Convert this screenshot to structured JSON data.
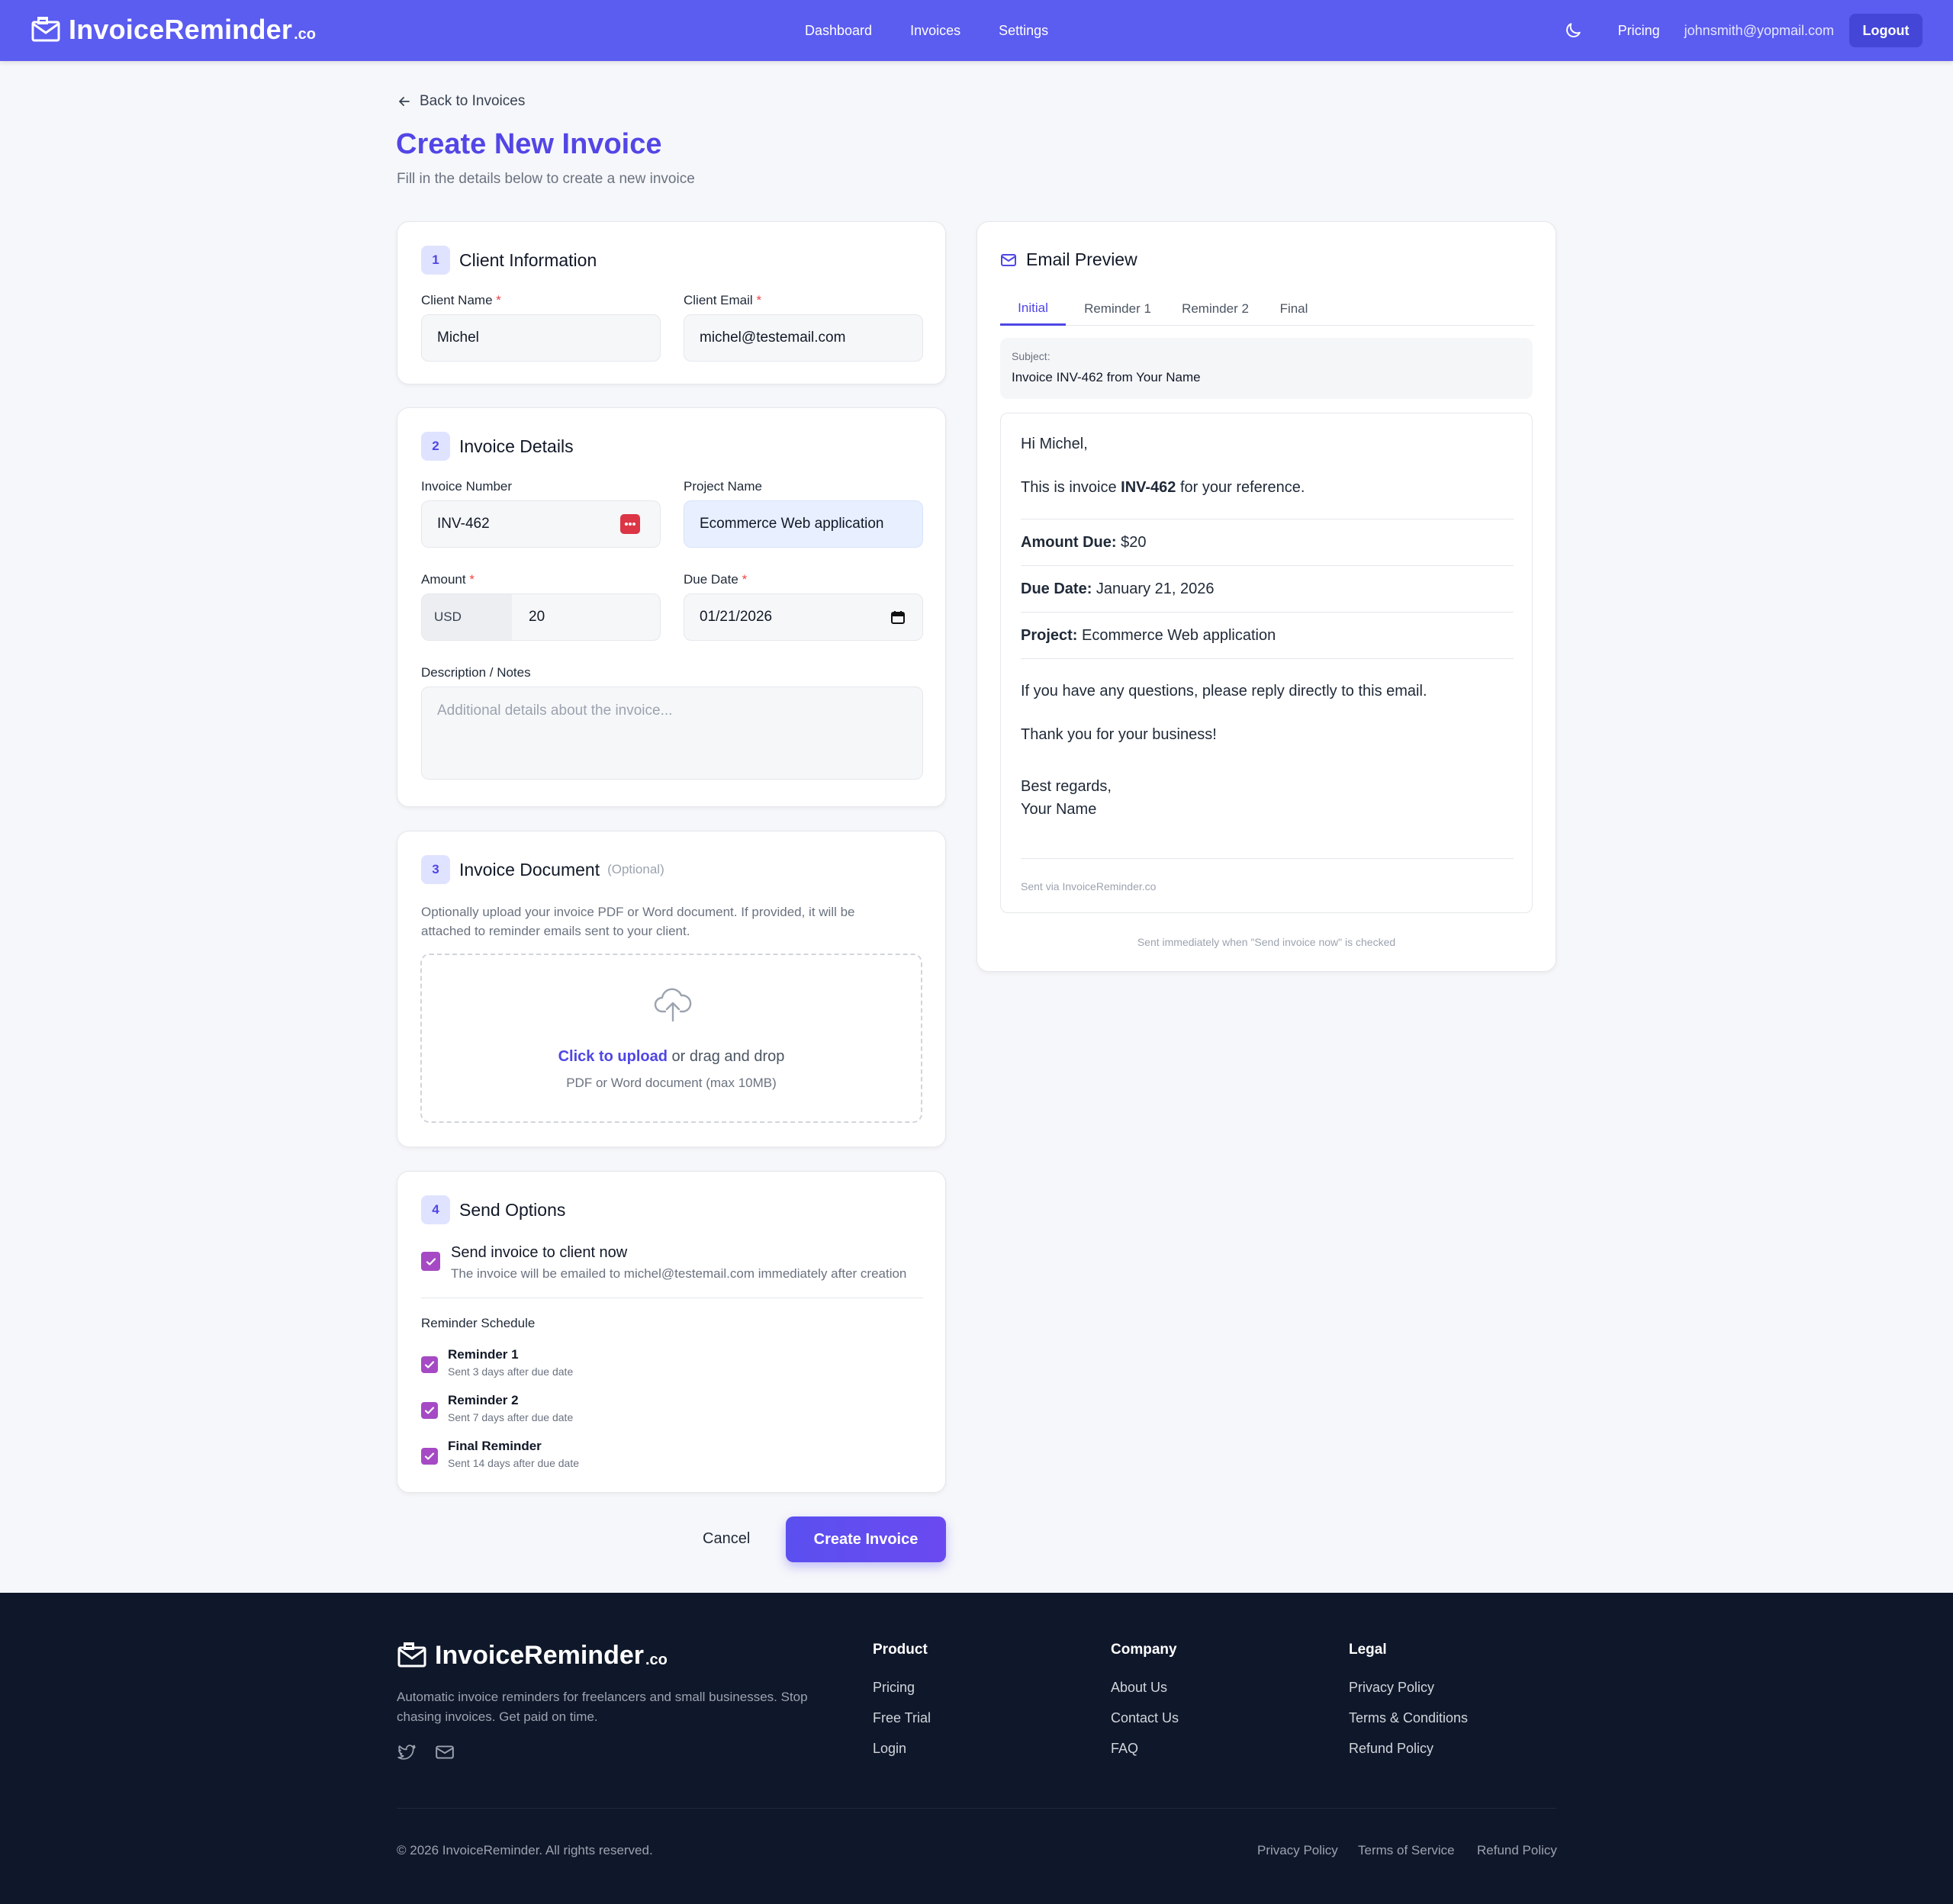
{
  "nav": {
    "brand": "InvoiceReminder",
    "brand_tld": ".co",
    "links": [
      "Dashboard",
      "Invoices",
      "Settings"
    ],
    "pricing": "Pricing",
    "user_email": "johnsmith@yopmail.com",
    "logout": "Logout"
  },
  "header": {
    "back": "Back to Invoices",
    "title": "Create New Invoice",
    "subtitle": "Fill in the details below to create a new invoice"
  },
  "client": {
    "step": "1",
    "title": "Client Information",
    "name_label": "Client Name",
    "name_value": "Michel",
    "email_label": "Client Email",
    "email_value": "michel@testemail.com",
    "required_mark": "*"
  },
  "details": {
    "step": "2",
    "title": "Invoice Details",
    "number_label": "Invoice Number",
    "number_value": "INV-462",
    "project_label": "Project Name",
    "project_value": "Ecommerce Web application",
    "amount_label": "Amount",
    "currency": "USD",
    "amount_value": "20",
    "due_label": "Due Date",
    "due_value": "01/21/2026",
    "notes_label": "Description / Notes",
    "notes_placeholder": "Additional details about the invoice..."
  },
  "document": {
    "step": "3",
    "title": "Invoice Document",
    "optional": "(Optional)",
    "help_line1": "Optionally upload your invoice PDF or Word document. If provided, it will be",
    "help_line2": "attached to reminder emails sent to your client.",
    "upload_link": "Click to upload",
    "upload_rest": " or drag and drop",
    "upload_hint": "PDF or Word document (max 10MB)"
  },
  "send": {
    "step": "4",
    "title": "Send Options",
    "send_now_label": "Send invoice to client now",
    "send_now_desc": "The invoice will be emailed to michel@testemail.com immediately after creation",
    "schedule_label": "Reminder Schedule",
    "reminders": [
      {
        "label": "Reminder 1",
        "desc": "Sent 3 days after due date"
      },
      {
        "label": "Reminder 2",
        "desc": "Sent 7 days after due date"
      },
      {
        "label": "Final Reminder",
        "desc": "Sent 14 days after due date"
      }
    ]
  },
  "actions": {
    "cancel": "Cancel",
    "create": "Create Invoice"
  },
  "preview": {
    "title": "Email Preview",
    "tabs": [
      "Initial",
      "Reminder 1",
      "Reminder 2",
      "Final"
    ],
    "active_tab": "Initial",
    "subject_label": "Subject:",
    "subject": "Invoice INV-462 from Your Name",
    "greeting": "Hi Michel,",
    "intro_pre": "This is invoice ",
    "intro_bold": "INV-462",
    "intro_post": " for your reference.",
    "amount_label": "Amount Due:",
    "amount_value": " $20",
    "due_label": "Due Date:",
    "due_value": " January 21, 2026",
    "project_label": "Project:",
    "project_value": " Ecommerce Web application",
    "questions": "If you have any questions, please reply directly to this email.",
    "thanks": "Thank you for your business!",
    "regards": "Best regards,",
    "signature": "Your Name",
    "sent_via": "Sent via InvoiceReminder.co",
    "note": "Sent immediately when \"Send invoice now\" is checked"
  },
  "footer": {
    "brand": "InvoiceReminder",
    "brand_tld": ".co",
    "tagline": "Automatic invoice reminders for freelancers and small businesses. Stop chasing invoices. Get paid on time.",
    "columns": [
      {
        "title": "Product",
        "links": [
          "Pricing",
          "Free Trial",
          "Login"
        ]
      },
      {
        "title": "Company",
        "links": [
          "About Us",
          "Contact Us",
          "FAQ"
        ]
      },
      {
        "title": "Legal",
        "links": [
          "Privacy Policy",
          "Terms & Conditions",
          "Refund Policy"
        ]
      }
    ],
    "copyright": "© 2026 InvoiceReminder. All rights reserved.",
    "bottom_links": [
      "Privacy Policy",
      "Terms of Service",
      "Refund Policy"
    ]
  },
  "colors": {
    "nav_bg": "#5b5cf0",
    "accent": "#5346e6",
    "checkbox": "#a54ac4",
    "footer_bg": "#0f172a"
  }
}
